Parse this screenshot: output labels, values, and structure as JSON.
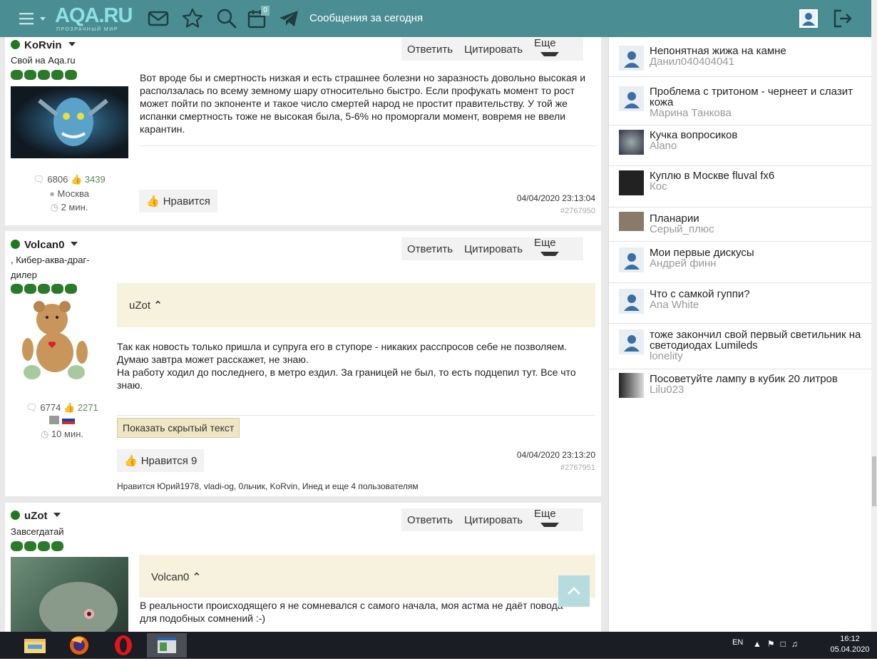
{
  "header": {
    "logo": "AQA.RU",
    "logo_sub": "ПРОЗРАЧНЫЙ МИР",
    "title": "Сообщения за сегодня",
    "calendar_badge": "0",
    "icons": [
      "menu-icon",
      "mail-icon",
      "star-icon",
      "search-icon",
      "calendar-icon",
      "telegram-icon",
      "avatar-icon",
      "logout-icon"
    ]
  },
  "actions": {
    "reply": "Ответить",
    "quote": "Цитировать",
    "more": "Еще"
  },
  "posts": [
    {
      "user": "KoRvin",
      "status": "Свой на Aqa.ru",
      "fish": 5,
      "messages": "6806",
      "likes_received": "3439",
      "city": "Москва",
      "ago": "2 мин.",
      "text": "Вот вроде бы и смертность низкая и есть страшнее болезни но заразность довольно высокая и расползалась по всему земному шару относительно быстро. Если профукать момент то рост может пойти по экпоненте и такое число смертей народ не простит правительству. У той же испанки смертность тоже не высокая была, 5-6% но проморгали момент, вовремя не ввели карантин.",
      "like_label": "Нравится",
      "date": "04/04/2020 23:13:04",
      "id": "#2767950"
    },
    {
      "user": "Volcan0",
      "status": ", Кибер-аква-драг-дилер",
      "fish": 5,
      "messages": "6774",
      "likes_received": "2271",
      "ago": "10 мин.",
      "quote_author": "uZot",
      "text_lines": [
        "Так как новость только пришла и супруга его в ступоре - никаких расспросов себе не позволяем.",
        "Думаю завтра может расскажет, не знаю.",
        "На работу ходил до последнего, в метро ездил. За границей не был, то есть подцепил тут. Все что знаю."
      ],
      "hidden_btn": "Показать скрытый текст",
      "like_label": "Нравится 9",
      "date": "04/04/2020 23:13:20",
      "id": "#2767951",
      "likers": "Нравится Юрий1978, vladi-og, 0льчик, KoRvin, Инед и еще 4 пользователям"
    },
    {
      "user": "uZot",
      "status": "Завсегдатай",
      "fish": 4,
      "quote_author": "Volcan0",
      "text": "В реальности происходящего я не сомневался с самого начала, моя астма не даёт повода для подобных сомнений :-)"
    }
  ],
  "sidebar": [
    {
      "title": "Непонятная жижа на камне",
      "author": "Данил040404041",
      "avatar": "default"
    },
    {
      "title": "Проблема с тритоном - чернеет и слазит кожа",
      "author": "Марина Танкова",
      "avatar": "default"
    },
    {
      "title": "Кучка вопросиков",
      "author": "Alano",
      "avatar": "photo"
    },
    {
      "title": "Куплю в Москве fluval fx6",
      "author": "Кос",
      "avatar": "dark"
    },
    {
      "title": "Планарии",
      "author": "Серый_плюс",
      "avatar": "koala"
    },
    {
      "title": "Мои первые дискусы",
      "author": "Андрей финн",
      "avatar": "default"
    },
    {
      "title": "Что с самкой гуппи?",
      "author": "Ana White",
      "avatar": "default"
    },
    {
      "title": "тоже закончил свой первый светильник на светодиодах Lumileds",
      "author": "lonelity",
      "avatar": "default"
    },
    {
      "title": "Посоветуйте лампу в кубик 20 литров",
      "author": "Lilu023",
      "avatar": "photo2"
    }
  ],
  "taskbar": {
    "lang": "EN",
    "time": "16:12",
    "date": "05.04.2020"
  },
  "colors": {
    "header": "#4a8e93",
    "accent_green": "#1f7a1f",
    "quote_bg": "#f6f2dd"
  }
}
